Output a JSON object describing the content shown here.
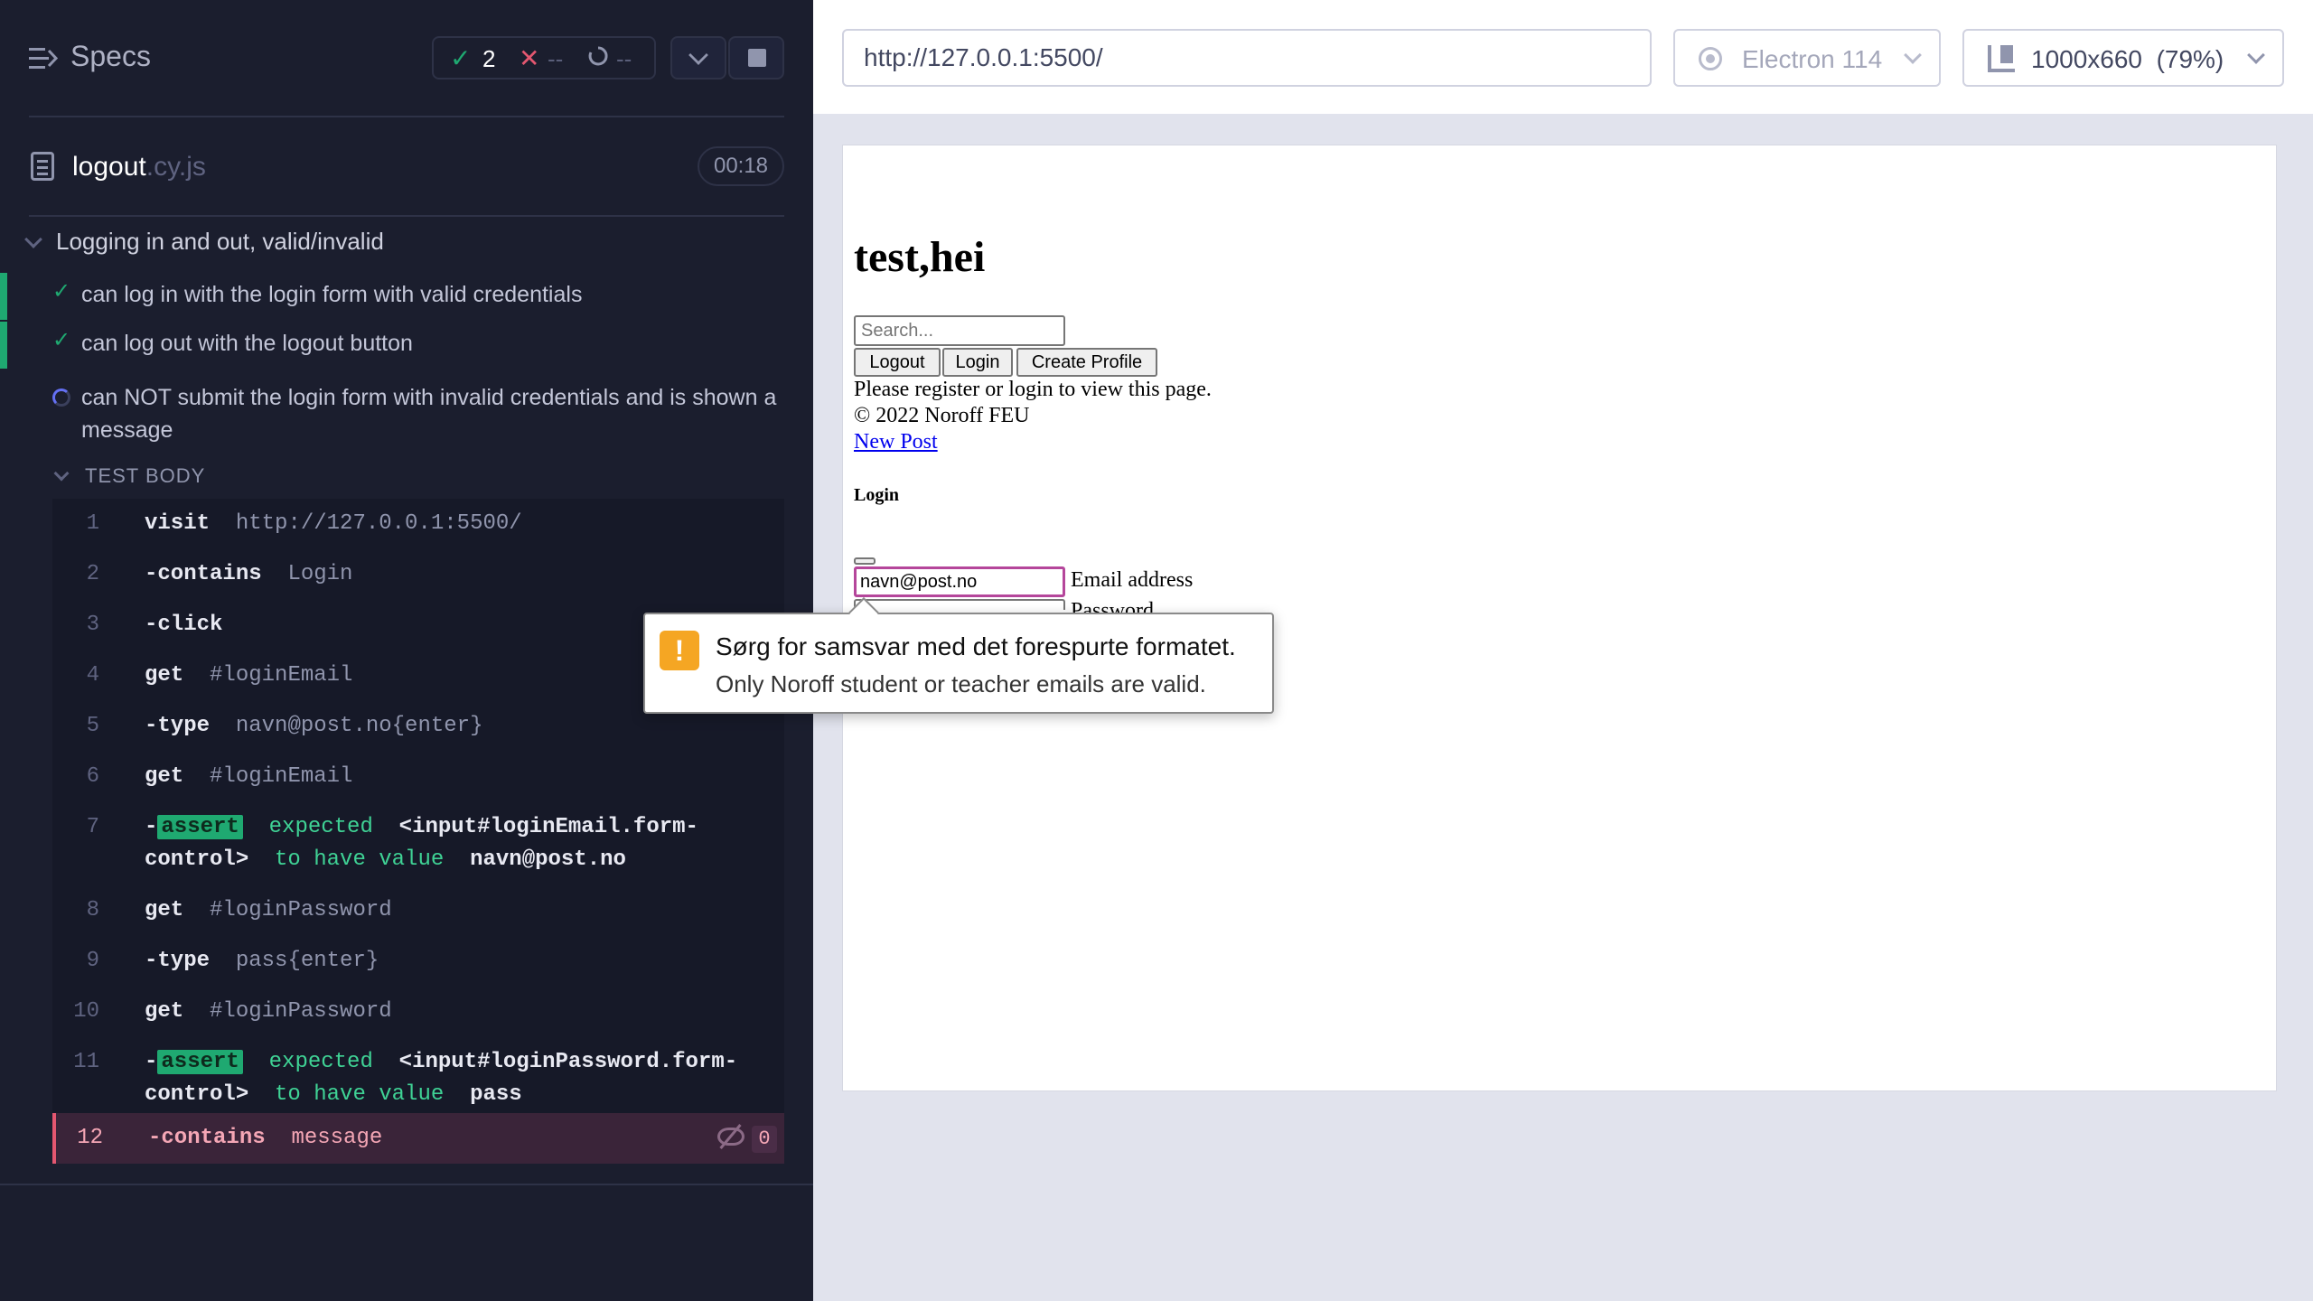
{
  "reporter": {
    "header": {
      "title": "Specs",
      "passed": "2",
      "failed": "--",
      "pending": "--"
    },
    "file": {
      "name": "logout",
      "ext": ".cy.js",
      "duration": "00:18"
    },
    "suite_title": "Logging in and out, valid/invalid",
    "tests": [
      {
        "label": "can log in with the login form with valid credentials",
        "state": "passed"
      },
      {
        "label": "can log out with the logout button",
        "state": "passed"
      },
      {
        "label": "can NOT submit the login form with invalid credentials and is shown a message",
        "state": "running"
      }
    ],
    "test_body_label": "TEST BODY",
    "commands": [
      {
        "num": "1",
        "name": "visit",
        "arg": "http://127.0.0.1:5500/"
      },
      {
        "num": "2",
        "name": "-contains",
        "arg": "Login"
      },
      {
        "num": "3",
        "name": "-click",
        "arg": ""
      },
      {
        "num": "4",
        "name": "get",
        "arg": "#loginEmail"
      },
      {
        "num": "5",
        "name": "-type",
        "arg": "navn@post.no{enter}"
      },
      {
        "num": "6",
        "name": "get",
        "arg": "#loginEmail"
      },
      {
        "num": "7",
        "name": "-",
        "badge": "assert",
        "t1": "expected",
        "t2": "<input#loginEmail.form-",
        "t3": "control>",
        "t4": "to have value",
        "t5": "navn@post.no"
      },
      {
        "num": "8",
        "name": "get",
        "arg": "#loginPassword"
      },
      {
        "num": "9",
        "name": "-type",
        "arg": "pass{enter}"
      },
      {
        "num": "10",
        "name": "get",
        "arg": "#loginPassword"
      },
      {
        "num": "11",
        "name": "-",
        "badge": "assert",
        "t1": "expected",
        "t2": "<input#loginPassword.form-",
        "t3": "control>",
        "t4": "to have value",
        "t5": "pass"
      },
      {
        "num": "12",
        "name": "-contains",
        "arg": "message",
        "count": "0"
      }
    ]
  },
  "browser": {
    "url": "http://127.0.0.1:5500/",
    "browser_name": "Electron 114",
    "viewport": "1000x660  (79%)"
  },
  "aut": {
    "title": "test,hei",
    "search_placeholder": "Search...",
    "buttons": [
      "Logout",
      "Login",
      "Create Profile"
    ],
    "message": "Please register or login to view this page.",
    "copyright": "© 2022 Noroff FEU",
    "new_post": "New Post",
    "login_heading": "Login",
    "email_value": "navn@post.no",
    "email_label": "Email address",
    "password_label": "Password"
  },
  "tooltip": {
    "title": "Sørg for samsvar med det forespurte formatet.",
    "subtitle": "Only Noroff student or teacher emails are valid."
  },
  "colors": {
    "pass": "#1fa971",
    "fail": "#e45770",
    "running": "#6470f3",
    "reporter_bg": "#1b1e2e",
    "warning": "#f5a623"
  }
}
